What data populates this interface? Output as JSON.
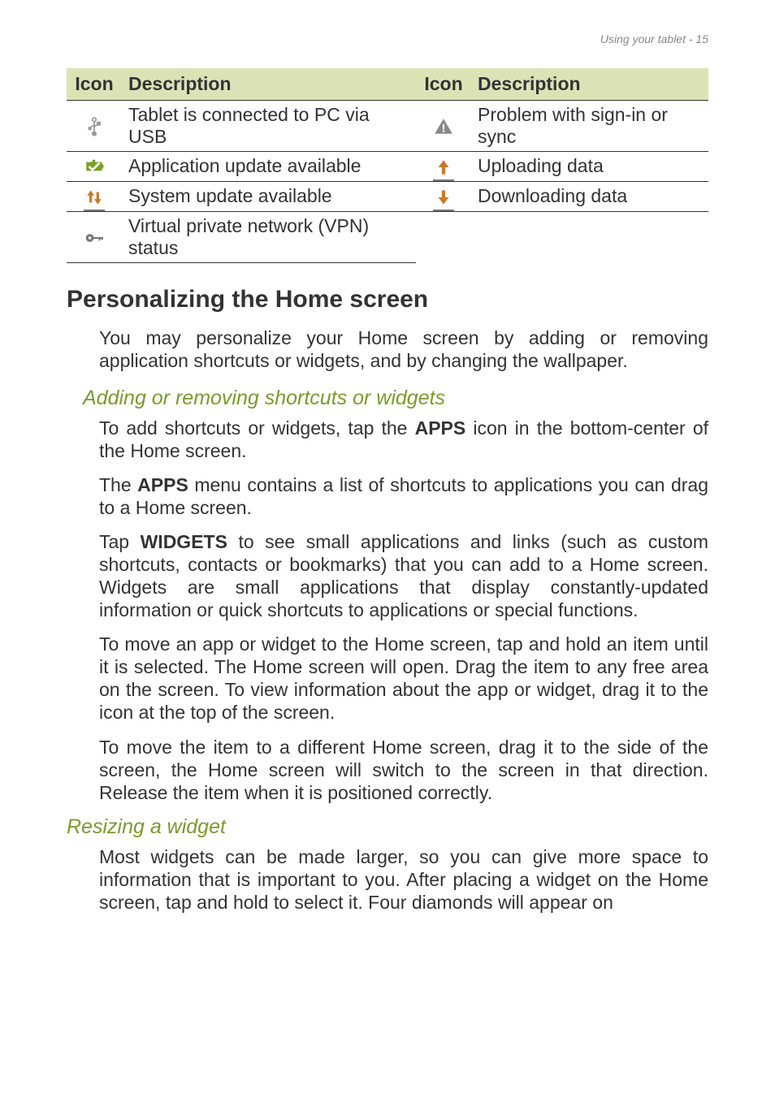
{
  "header": {
    "text": "Using your tablet - 15"
  },
  "table": {
    "headers": {
      "icon1": "Icon",
      "desc1": "Description",
      "icon2": "Icon",
      "desc2": "Description"
    },
    "rows": [
      {
        "icon1": "usb-icon",
        "desc1": "Tablet is connected to PC via USB",
        "icon2": "warning-icon",
        "desc2": "Problem with sign-in or sync"
      },
      {
        "icon1": "update-badge-icon",
        "desc1": "Application update available",
        "icon2": "upload-icon",
        "desc2": "Uploading data"
      },
      {
        "icon1": "updown-arrows-icon",
        "desc1": "System update available",
        "icon2": "download-icon",
        "desc2": "Downloading data"
      },
      {
        "icon1": "vpn-key-icon",
        "desc1": "Virtual private network (VPN) status",
        "icon2": "",
        "desc2": ""
      }
    ]
  },
  "sections": {
    "h2": "Personalizing the Home screen",
    "p1": "You may personalize your Home screen by adding or removing application shortcuts or widgets, and by changing the wallpaper.",
    "sub1": "Adding or removing shortcuts or widgets",
    "p2a": "To add shortcuts or widgets, tap the ",
    "p2b": "APPS",
    "p2c": " icon in the bottom-center of the Home screen.",
    "p3a": "The ",
    "p3b": "APPS",
    "p3c": " menu contains a list of shortcuts to applications you can drag to a Home screen.",
    "p4a": "Tap ",
    "p4b": "WIDGETS",
    "p4c": " to see small applications and links (such as custom shortcuts, contacts or bookmarks) that you can add to a Home screen. Widgets are small applications that display constantly-updated information or quick shortcuts to applications or special functions.",
    "p5": "To move an app or widget to the Home screen, tap and hold an item until it is selected. The Home screen will open. Drag the item to any free area on the screen. To view information about the app or widget, drag it to the icon at the top of the screen.",
    "p6": "To move the item to a different Home screen, drag it to the side of the screen, the Home screen will switch to the screen in that direction. Release the item when it is positioned correctly.",
    "sub2": "Resizing a widget",
    "p7": "Most widgets can be made larger, so you can give more space to information that is important to you. After placing a widget on the Home screen, tap and hold to select it. Four diamonds will appear on"
  }
}
